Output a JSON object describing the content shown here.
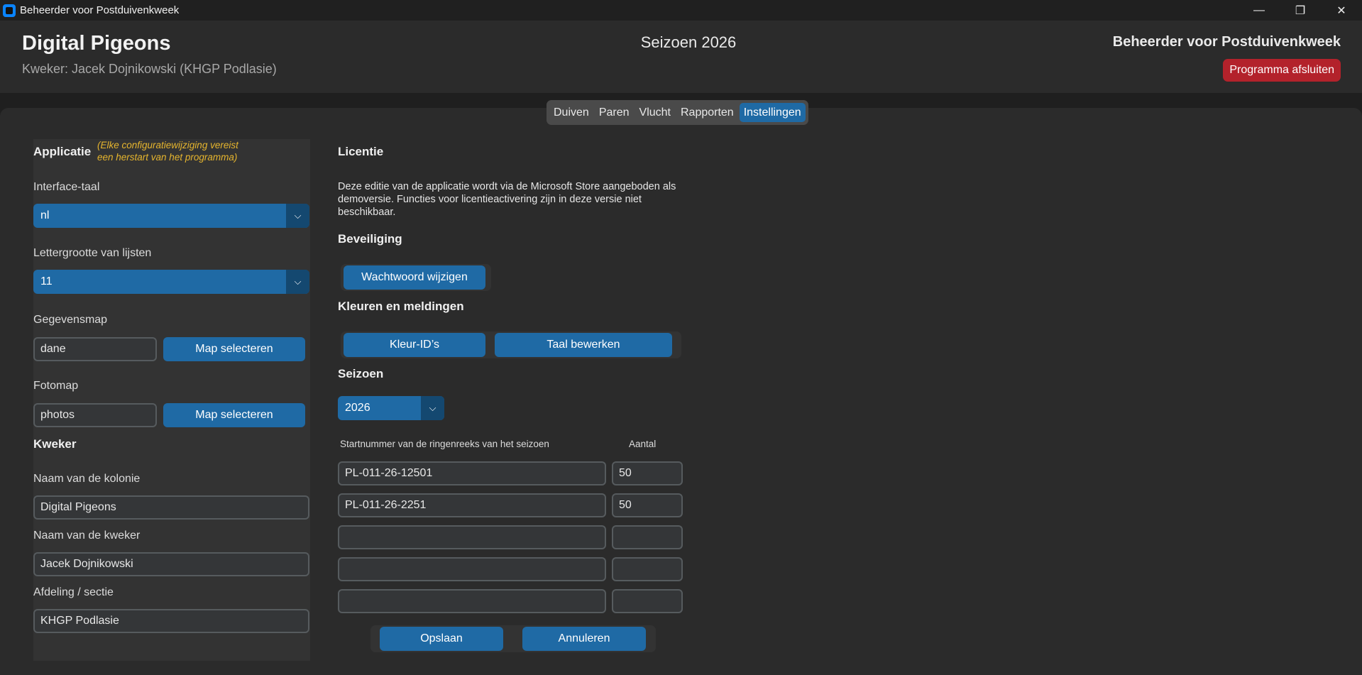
{
  "window": {
    "title": "Beheerder voor Postduivenkweek",
    "controls": {
      "minimize": "—",
      "maximize": "❐",
      "close": "✕"
    }
  },
  "header": {
    "colony_name": "Digital Pigeons",
    "breeder_line": "Kweker: Jacek Dojnikowski (KHGP Podlasie)",
    "season_title": "Seizoen 2026",
    "app_name": "Beheerder voor Postduivenkweek",
    "exit_label": "Programma afsluiten"
  },
  "tabs": [
    {
      "label": "Duiven"
    },
    {
      "label": "Paren"
    },
    {
      "label": "Vlucht"
    },
    {
      "label": "Rapporten"
    },
    {
      "label": "Instellingen",
      "active": true
    }
  ],
  "application": {
    "title": "Applicatie",
    "note_line1": "(Elke configuratiewijziging vereist",
    "note_line2": "een herstart van het programma)",
    "language_label": "Interface-taal",
    "language_value": "nl",
    "fontsize_label": "Lettergrootte van lijsten",
    "fontsize_value": "11",
    "datafolder_label": "Gegevensmap",
    "datafolder_value": "dane",
    "datafolder_button": "Map selecteren",
    "photofolder_label": "Fotomap",
    "photofolder_value": "photos",
    "photofolder_button": "Map selecteren"
  },
  "breeder": {
    "title": "Kweker",
    "colony_label": "Naam van de kolonie",
    "colony_value": "Digital Pigeons",
    "name_label": "Naam van de kweker",
    "name_value": "Jacek Dojnikowski",
    "section_label": "Afdeling / sectie",
    "section_value": "KHGP Podlasie"
  },
  "license": {
    "title": "Licentie",
    "line1": "Deze editie van de applicatie wordt via de Microsoft Store aangeboden als",
    "line2": "demoversie. Functies voor licentieactivering zijn in deze versie niet",
    "line3": "beschikbaar."
  },
  "security": {
    "title": "Beveiliging",
    "change_password": "Wachtwoord wijzigen"
  },
  "colors": {
    "title": "Kleuren en meldingen",
    "color_ids": "Kleur-ID’s",
    "edit_language": "Taal bewerken"
  },
  "season": {
    "title": "Seizoen",
    "year_value": "2026",
    "ring_header": "Startnummer van de ringenreeks van het seizoen",
    "count_header": "Aantal",
    "rows": [
      {
        "ring": "PL-011-26-12501",
        "count": "50"
      },
      {
        "ring": "PL-011-26-2251",
        "count": "50"
      },
      {
        "ring": "",
        "count": ""
      },
      {
        "ring": "",
        "count": ""
      },
      {
        "ring": "",
        "count": ""
      }
    ],
    "save": "Opslaan",
    "cancel": "Annuleren"
  },
  "icons": {
    "app": "app-logo-icon",
    "dropdown": "chevron-down-icon"
  },
  "palette": {
    "accent": "#1f6aa5",
    "accent_dark": "#144870",
    "danger": "#b3222b",
    "note": "#e6b52e"
  }
}
